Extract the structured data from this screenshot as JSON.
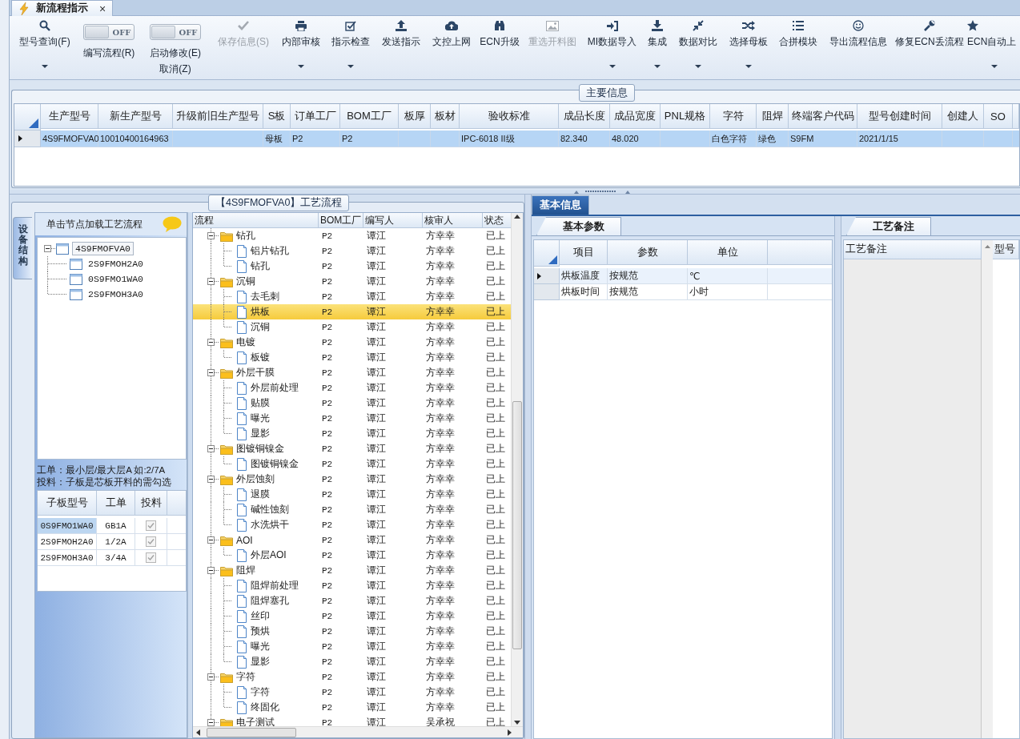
{
  "tab": {
    "title": "新流程指示",
    "close": "×"
  },
  "toolbar": [
    {
      "kind": "button",
      "label": "型号查询(F)",
      "disabled": false,
      "dropdown": true
    },
    {
      "kind": "toggle",
      "label": "编写流程(R)",
      "state_text": "OFF",
      "on": false
    },
    {
      "kind": "toggle",
      "label": "启动修改(E)",
      "label2": "取消(Z)",
      "state_text": "OFF",
      "on": false
    },
    {
      "kind": "button",
      "label": "保存信息(S)",
      "disabled": true,
      "dropdown": false
    },
    {
      "kind": "button",
      "label": "内部审核",
      "disabled": false,
      "dropdown": true
    },
    {
      "kind": "button",
      "label": "指示检查",
      "disabled": false,
      "dropdown": true
    },
    {
      "kind": "button",
      "label": "发送指示",
      "disabled": false,
      "dropdown": false
    },
    {
      "kind": "button",
      "label": "文控上网",
      "disabled": false,
      "dropdown": false
    },
    {
      "kind": "button",
      "label": "ECN升级",
      "disabled": false,
      "dropdown": false
    },
    {
      "kind": "button",
      "label": "重选开料图",
      "disabled": true,
      "dropdown": false
    },
    {
      "kind": "button",
      "label": "MI数据导入",
      "disabled": false,
      "dropdown": true
    },
    {
      "kind": "button",
      "label": "集成",
      "disabled": false,
      "dropdown": true
    },
    {
      "kind": "button",
      "label": "数据对比",
      "disabled": false,
      "dropdown": true
    },
    {
      "kind": "button",
      "label": "选择母板",
      "disabled": false,
      "dropdown": true
    },
    {
      "kind": "button",
      "label": "合拼模块",
      "disabled": false,
      "dropdown": false
    },
    {
      "kind": "button",
      "label": "导出流程信息",
      "disabled": false,
      "dropdown": false
    },
    {
      "kind": "button",
      "label": "修复ECN丢流程",
      "disabled": false,
      "dropdown": false
    },
    {
      "kind": "button",
      "label": "ECN自动上",
      "disabled": false,
      "dropdown": true
    }
  ],
  "main_info": {
    "title": "主要信息",
    "columns": [
      "生产型号",
      "新生产型号",
      "升级前旧生产型号",
      "S板",
      "订单工厂",
      "BOM工厂",
      "板厚",
      "板材",
      "验收标准",
      "成品长度",
      "成品宽度",
      "PNL规格",
      "字符",
      "阻焊",
      "终端客户代码",
      "型号创建时间",
      "创建人",
      "SO"
    ],
    "rows": [
      {
        "selected": true,
        "cells": [
          "4S9FMOFVA0",
          "10010400164963",
          null,
          "母板",
          "P2",
          "P2",
          null,
          null,
          "IPC-6018 II级",
          "82.340",
          "48.020",
          null,
          "白色字符",
          "绿色",
          "S9FM",
          "2021/1/15",
          null,
          null
        ]
      }
    ]
  },
  "process_panel": {
    "title": "【4S9FMOFVA0】工艺流程",
    "side_tab": "设备结构",
    "hint": "单击节点加载工艺流程",
    "tree": [
      {
        "label": "4S9FMOFVA0",
        "selected": true,
        "expanded": true,
        "children": [
          {
            "label": "2S9FMOH2A0",
            "selected": false
          },
          {
            "label": "0S9FMO1WA0",
            "selected": false
          },
          {
            "label": "2S9FMOH3A0",
            "selected": false
          }
        ]
      }
    ],
    "notes": [
      "工单：最小层/最大层A 如:2/7A",
      "投料：子板是芯板开料的需勾选"
    ],
    "sub_boards": {
      "columns": [
        "子板型号",
        "工单",
        "投料"
      ],
      "rows": [
        {
          "board": "0S9FMO1WA0",
          "order": "GB1A",
          "checked": true,
          "selected": true
        },
        {
          "board": "2S9FMOH2A0",
          "order": "1/2A",
          "checked": true,
          "selected": false
        },
        {
          "board": "2S9FMOH3A0",
          "order": "3/4A",
          "checked": true,
          "selected": false
        }
      ]
    },
    "flow": {
      "columns": [
        "流程",
        "BOM工厂",
        "编写人",
        "核审人",
        "状态"
      ],
      "rows": [
        {
          "name": "钻孔",
          "bom": "P2",
          "writer": "谭江",
          "reviewer": "方幸幸",
          "status": "已上",
          "expanded": true,
          "selected": false,
          "children": [
            {
              "name": "铝片钻孔",
              "bom": "P2",
              "writer": "谭江",
              "reviewer": "方幸幸",
              "status": "已上",
              "selected": false
            },
            {
              "name": "钻孔",
              "bom": "P2",
              "writer": "谭江",
              "reviewer": "方幸幸",
              "status": "已上",
              "selected": false
            }
          ]
        },
        {
          "name": "沉铜",
          "bom": "P2",
          "writer": "谭江",
          "reviewer": "方幸幸",
          "status": "已上",
          "expanded": true,
          "selected": false,
          "children": [
            {
              "name": "去毛刺",
              "bom": "P2",
              "writer": "谭江",
              "reviewer": "方幸幸",
              "status": "已上",
              "selected": false
            },
            {
              "name": "烘板",
              "bom": "P2",
              "writer": "谭江",
              "reviewer": "方幸幸",
              "status": "已上",
              "selected": true
            },
            {
              "name": "沉铜",
              "bom": "P2",
              "writer": "谭江",
              "reviewer": "方幸幸",
              "status": "已上",
              "selected": false
            }
          ]
        },
        {
          "name": "电镀",
          "bom": "P2",
          "writer": "谭江",
          "reviewer": "方幸幸",
          "status": "已上",
          "expanded": true,
          "selected": false,
          "children": [
            {
              "name": "板镀",
              "bom": "P2",
              "writer": "谭江",
              "reviewer": "方幸幸",
              "status": "已上",
              "selected": false
            }
          ]
        },
        {
          "name": "外层干膜",
          "bom": "P2",
          "writer": "谭江",
          "reviewer": "方幸幸",
          "status": "已上",
          "expanded": true,
          "selected": false,
          "children": [
            {
              "name": "外层前处理",
              "bom": "P2",
              "writer": "谭江",
              "reviewer": "方幸幸",
              "status": "已上",
              "selected": false
            },
            {
              "name": "贴膜",
              "bom": "P2",
              "writer": "谭江",
              "reviewer": "方幸幸",
              "status": "已上",
              "selected": false
            },
            {
              "name": "曝光",
              "bom": "P2",
              "writer": "谭江",
              "reviewer": "方幸幸",
              "status": "已上",
              "selected": false
            },
            {
              "name": "显影",
              "bom": "P2",
              "writer": "谭江",
              "reviewer": "方幸幸",
              "status": "已上",
              "selected": false
            }
          ]
        },
        {
          "name": "图镀铜镍金",
          "bom": "P2",
          "writer": "谭江",
          "reviewer": "方幸幸",
          "status": "已上",
          "expanded": true,
          "selected": false,
          "children": [
            {
              "name": "图镀铜镍金",
              "bom": "P2",
              "writer": "谭江",
              "reviewer": "方幸幸",
              "status": "已上",
              "selected": false
            }
          ]
        },
        {
          "name": "外层蚀刻",
          "bom": "P2",
          "writer": "谭江",
          "reviewer": "方幸幸",
          "status": "已上",
          "expanded": true,
          "selected": false,
          "children": [
            {
              "name": "退膜",
              "bom": "P2",
              "writer": "谭江",
              "reviewer": "方幸幸",
              "status": "已上",
              "selected": false
            },
            {
              "name": "碱性蚀刻",
              "bom": "P2",
              "writer": "谭江",
              "reviewer": "方幸幸",
              "status": "已上",
              "selected": false
            },
            {
              "name": "水洗烘干",
              "bom": "P2",
              "writer": "谭江",
              "reviewer": "方幸幸",
              "status": "已上",
              "selected": false
            }
          ]
        },
        {
          "name": "AOI",
          "bom": "P2",
          "writer": "谭江",
          "reviewer": "方幸幸",
          "status": "已上",
          "expanded": true,
          "selected": false,
          "children": [
            {
              "name": "外层AOI",
              "bom": "P2",
              "writer": "谭江",
              "reviewer": "方幸幸",
              "status": "已上",
              "selected": false
            }
          ]
        },
        {
          "name": "阻焊",
          "bom": "P2",
          "writer": "谭江",
          "reviewer": "方幸幸",
          "status": "已上",
          "expanded": true,
          "selected": false,
          "children": [
            {
              "name": "阻焊前处理",
              "bom": "P2",
              "writer": "谭江",
              "reviewer": "方幸幸",
              "status": "已上",
              "selected": false
            },
            {
              "name": "阻焊塞孔",
              "bom": "P2",
              "writer": "谭江",
              "reviewer": "方幸幸",
              "status": "已上",
              "selected": false
            },
            {
              "name": "丝印",
              "bom": "P2",
              "writer": "谭江",
              "reviewer": "方幸幸",
              "status": "已上",
              "selected": false
            },
            {
              "name": "预烘",
              "bom": "P2",
              "writer": "谭江",
              "reviewer": "方幸幸",
              "status": "已上",
              "selected": false
            },
            {
              "name": "曝光",
              "bom": "P2",
              "writer": "谭江",
              "reviewer": "方幸幸",
              "status": "已上",
              "selected": false
            },
            {
              "name": "显影",
              "bom": "P2",
              "writer": "谭江",
              "reviewer": "方幸幸",
              "status": "已上",
              "selected": false
            }
          ]
        },
        {
          "name": "字符",
          "bom": "P2",
          "writer": "谭江",
          "reviewer": "方幸幸",
          "status": "已上",
          "expanded": true,
          "selected": false,
          "children": [
            {
              "name": "字符",
              "bom": "P2",
              "writer": "谭江",
              "reviewer": "方幸幸",
              "status": "已上",
              "selected": false
            },
            {
              "name": "终固化",
              "bom": "P2",
              "writer": "谭江",
              "reviewer": "方幸幸",
              "status": "已上",
              "selected": false
            }
          ]
        },
        {
          "name": "电子测试",
          "bom": "P2",
          "writer": "谭江",
          "reviewer": "吴承祝",
          "status": "已上",
          "expanded": true,
          "selected": false
        }
      ]
    }
  },
  "detail": {
    "tabs": [
      {
        "label": "基本信息",
        "selected": true
      }
    ],
    "params": {
      "title": "基本参数",
      "columns": [
        "项目",
        "参数",
        "单位"
      ],
      "rows": [
        {
          "item": "烘板温度",
          "value": "按规范",
          "unit": "℃",
          "selected": true
        },
        {
          "item": "烘板时间",
          "value": "按规范",
          "unit": "小时",
          "selected": false
        }
      ]
    },
    "remarks": {
      "title": "工艺备注",
      "columns": [
        "工艺备注",
        "型号"
      ]
    }
  }
}
